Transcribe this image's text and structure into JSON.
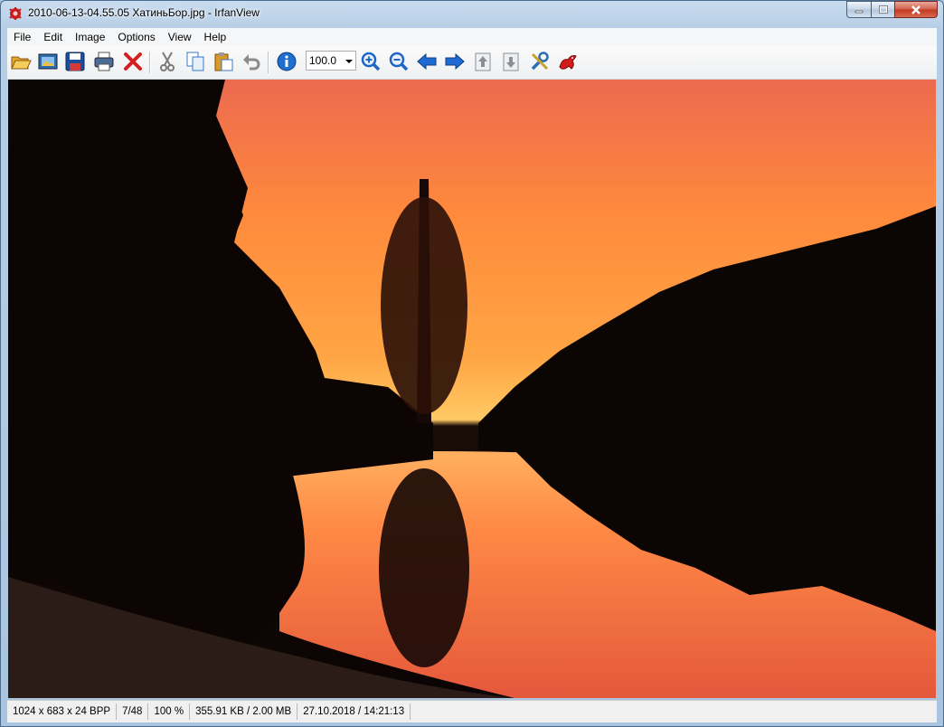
{
  "window": {
    "title": "2010-06-13-04.55.05 ХатиньБор.jpg - IrfanView",
    "app_icon": "irfanview-cat-icon",
    "controls": [
      "minimize-icon",
      "maximize-icon",
      "close-icon"
    ]
  },
  "menu": {
    "items": [
      "File",
      "Edit",
      "Image",
      "Options",
      "View",
      "Help"
    ]
  },
  "toolbar": {
    "buttons": [
      {
        "name": "open-icon",
        "color": "#e8a628"
      },
      {
        "name": "slideshow-icon",
        "color": "#2f6db3"
      },
      {
        "name": "save-icon",
        "color": "#1c4e9b"
      },
      {
        "name": "print-icon",
        "color": "#4a6d96"
      },
      {
        "name": "delete-icon",
        "color": "#d42020"
      },
      {
        "name": "cut-icon",
        "color": "#7a7a7a"
      },
      {
        "name": "copy-icon",
        "color": "#3a78c8"
      },
      {
        "name": "paste-icon",
        "color": "#d89b2a"
      },
      {
        "name": "undo-icon",
        "color": "#8a8a8a"
      },
      {
        "name": "info-icon",
        "color": "#1f6fd1"
      },
      {
        "name": "zoom-in-icon",
        "color": "#1f66c4"
      },
      {
        "name": "zoom-out-icon",
        "color": "#1f66c4"
      },
      {
        "name": "previous-icon",
        "color": "#1e6bd6"
      },
      {
        "name": "next-icon",
        "color": "#1e6bd6"
      },
      {
        "name": "first-page-icon",
        "color": "#8a8f96"
      },
      {
        "name": "last-page-icon",
        "color": "#8a8f96"
      },
      {
        "name": "settings-icon",
        "color": "#2f6db3"
      },
      {
        "name": "about-icon",
        "color": "#d41b1b"
      }
    ],
    "zoom_value": "100.0"
  },
  "image": {
    "description_icon": "photo-sunset-lake",
    "sky_top": "#f0704a",
    "sky_mid": "#ff9a3a",
    "horizon": "#ffd36a"
  },
  "status": {
    "dimensions": "1024 x 683 x 24 BPP",
    "index": "7/48",
    "zoom": "100 %",
    "size": "355.91 KB / 2.00 MB",
    "datetime": "27.10.2018 / 14:21:13"
  }
}
